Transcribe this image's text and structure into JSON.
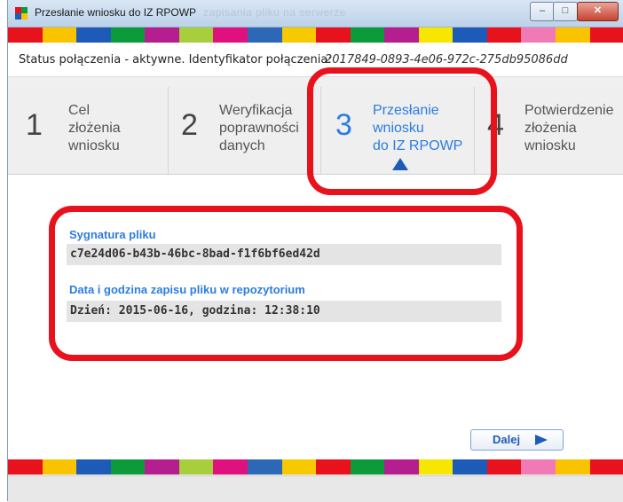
{
  "window": {
    "title": "Przesłanie wniosku do IZ RPOWP",
    "title_faded": "zapisania pliku na serwerze",
    "controls": {
      "minimize": "‒",
      "maximize": "□",
      "close": "✕"
    }
  },
  "colors": {
    "stripe": [
      "#e8121c",
      "#f9c300",
      "#1e5bb8",
      "#0c9b3a",
      "#b41e8e",
      "#a6cf3b",
      "#e0117f",
      "#2c68b6",
      "#f6c900",
      "#e8121c",
      "#0c9b3a",
      "#b41e8e",
      "#f6e600",
      "#1e5bb8",
      "#e8121c",
      "#f07ab3",
      "#f9c300",
      "#e8121c"
    ],
    "accent": "#2b7de0",
    "highlight": "#e8121c"
  },
  "status": {
    "label": "Status połączenia - aktywne. Identyfikator połączenia:",
    "identifier": "2017849-0893-4e06-972c-275db95086dd"
  },
  "steps": [
    {
      "number": "1",
      "label_lines": [
        "Cel",
        "złożenia",
        "wniosku"
      ],
      "active": false
    },
    {
      "number": "2",
      "label_lines": [
        "Weryfikacja",
        "poprawności",
        "danych"
      ],
      "active": false
    },
    {
      "number": "3",
      "label_lines": [
        "Przesłanie",
        "wniosku",
        "do IZ RPOWP"
      ],
      "active": true
    },
    {
      "number": "4",
      "label_lines": [
        "Potwierdzenie",
        "złożenia",
        "wniosku"
      ],
      "active": false
    }
  ],
  "result": {
    "signature_label": "Sygnatura pliku",
    "signature_value": "c7e24d06-b43b-46bc-8bad-f1f6bf6ed42d",
    "datetime_label": "Data i godzina zapisu pliku w repozytorium",
    "datetime_value": "Dzień: 2015-06-16, godzina: 12:38:10"
  },
  "buttons": {
    "next_label": "Dalej",
    "next_icon": "play-arrow-icon"
  }
}
